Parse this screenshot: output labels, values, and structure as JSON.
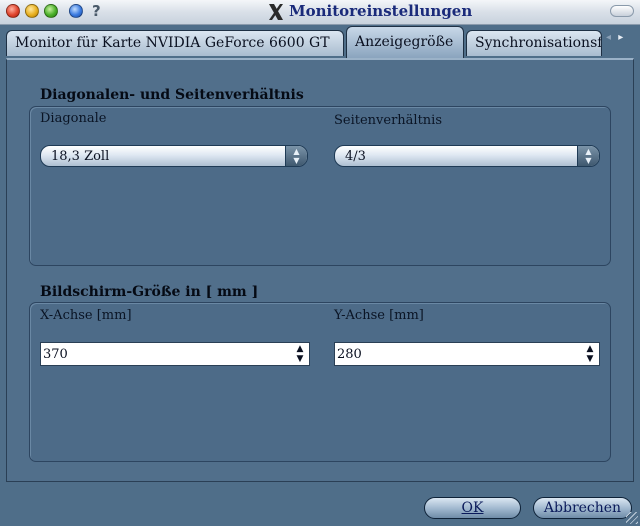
{
  "window": {
    "title": "Monitoreinstellungen",
    "help_label": "?"
  },
  "tabs": [
    {
      "label": "Monitor für Karte NVIDIA GeForce 6600 GT",
      "active": false
    },
    {
      "label": "Anzeigegröße",
      "active": true
    },
    {
      "label": "Synchronisationsf",
      "active": false
    }
  ],
  "tab_scroll": {
    "left": "◂",
    "right": "▸"
  },
  "diagonal_section": {
    "title": "Diagonalen- und Seitenverhältnis",
    "diagonal_label": "Diagonale",
    "diagonal_value": "18,3 Zoll",
    "aspect_label": "Seitenverhältnis",
    "aspect_value": "4/3"
  },
  "size_section": {
    "title": "Bildschirm-Größe in [ mm ]",
    "x_label": "X-Achse [mm]",
    "x_value": "370",
    "y_label": "Y-Achse [mm]",
    "y_value": "280"
  },
  "buttons": {
    "ok_label": "OK",
    "cancel_label": "Abbrechen"
  },
  "icons": {
    "combo_arrows": "▲▼",
    "spin_up": "▲",
    "spin_down": "▼",
    "app": "x-logo-icon"
  },
  "colors": {
    "title_text": "#1a2a7a",
    "panel_bg": "#516f8b",
    "window_bg": "#4f6e89"
  }
}
